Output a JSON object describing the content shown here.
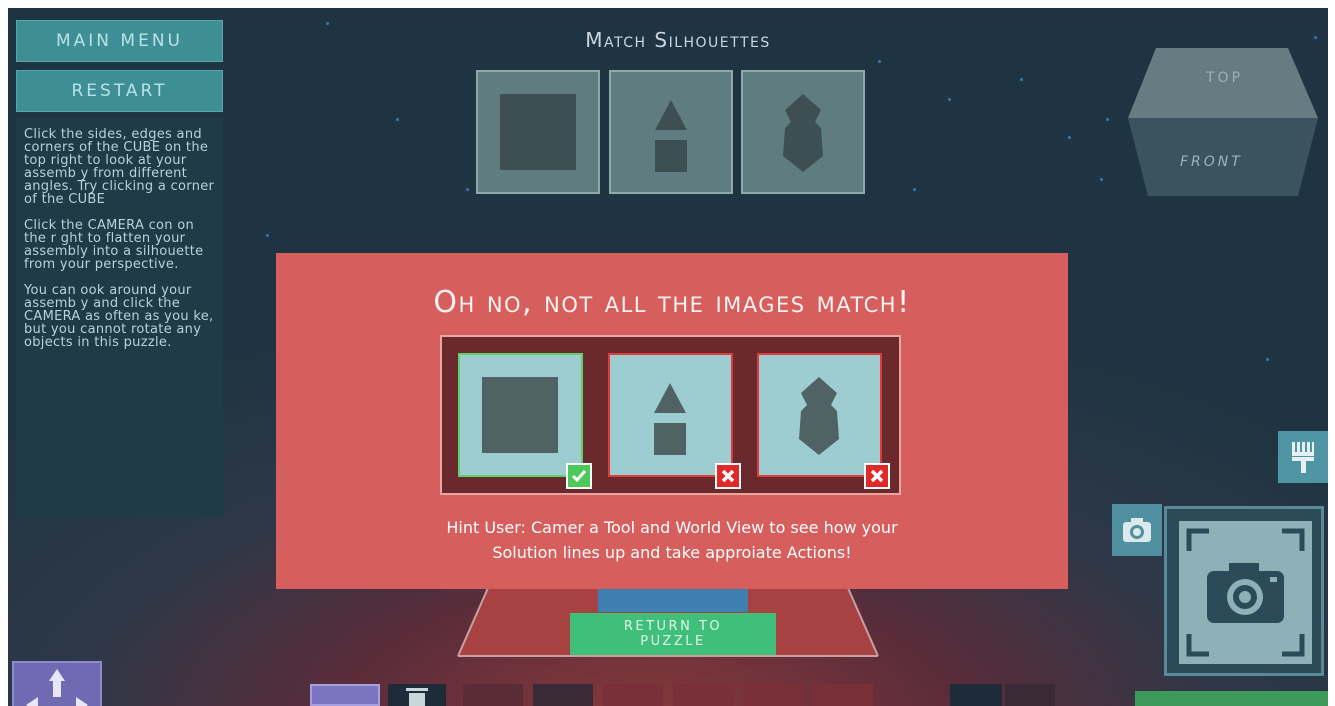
{
  "menu": {
    "main_menu_label": "MAIN MENU",
    "restart_label": "RESTART"
  },
  "instructions": {
    "paragraph1": "Click the sides, edges and corners of the CUBE on the top right to look at your assemb y from different angles. Try clicking a corner of the CUBE",
    "paragraph2": "Click the CAMERA con on the r ght to flatten your assembly into a silhouette from your perspective.",
    "paragraph3": "You can ook around your assemb y and click the CAMERA as often as you ke, but you cannot rotate any objects in this puzzle."
  },
  "puzzle": {
    "title": "Match Silhouettes",
    "target_shapes": [
      "square",
      "triangle-over-square",
      "stacked-hexagon"
    ]
  },
  "view_cube": {
    "top_label": "TOP",
    "front_label": "FRONT"
  },
  "modal": {
    "title": "Oh no, not all the images match!",
    "results": [
      {
        "shape": "square",
        "match": true
      },
      {
        "shape": "triangle-over-square",
        "match": false
      },
      {
        "shape": "stacked-hexagon",
        "match": false
      }
    ],
    "hint_line1": "Hint User: Camer a Tool and World View to see how your",
    "hint_line2": "Solution lines up and take approiate Actions!",
    "return_label_line1": "RETURN TO",
    "return_label_line2": "PUZZLE"
  },
  "icons": {
    "paint": "paint-brush-icon",
    "camera_small": "camera-icon",
    "camera_large": "camera-icon",
    "move": "move-arrows-icon",
    "trash": "trash-icon"
  },
  "colors": {
    "modal_bg": "#d65e5c",
    "match_ok": "#4dc95a",
    "match_bad": "#e02a2a",
    "button_teal": "#3d8f95",
    "button_green": "#3fbf79"
  }
}
